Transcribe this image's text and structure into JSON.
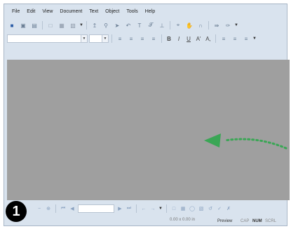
{
  "menu": [
    "File",
    "Edit",
    "View",
    "Document",
    "Text",
    "Object",
    "Tools",
    "Help"
  ],
  "format": {
    "bold": "B",
    "italic": "I",
    "underline": "U",
    "superscript": "A'",
    "subscript": "A,"
  },
  "status": {
    "dimensions": "0.00 x 0.00 in",
    "preview": "Preview",
    "caps": "CAP",
    "num": "NUM",
    "scroll": "SCRL"
  },
  "step_badge": "1",
  "colors": {
    "canvas": "#9f9f9f",
    "arrow": "#3aa655",
    "toolbar_bg": "#d9e3ee"
  }
}
